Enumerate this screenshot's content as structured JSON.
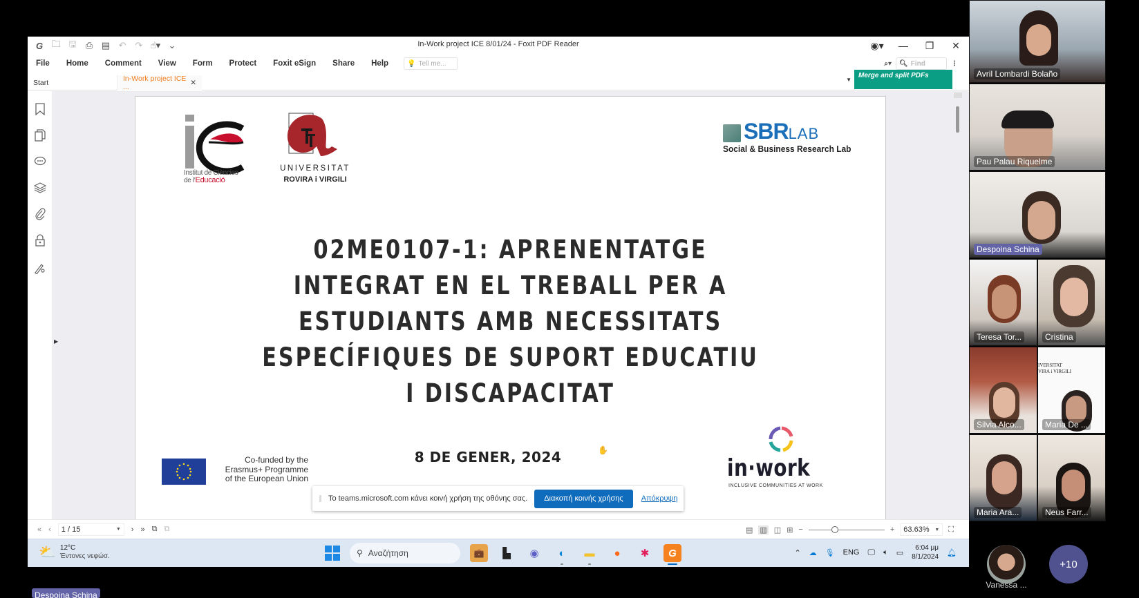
{
  "app": {
    "window_title": "In-Work project ICE 8/01/24 - Foxit PDF Reader",
    "menu": [
      "File",
      "Home",
      "Comment",
      "View",
      "Form",
      "Protect",
      "Foxit eSign",
      "Share",
      "Help"
    ],
    "tell_me_placeholder": "Tell me...",
    "find_placeholder": "Find",
    "tabs": [
      {
        "label": "Start",
        "active": false
      },
      {
        "label": "In-Work project ICE ...",
        "active": true
      }
    ],
    "merge_banner": "Merge and split PDFs",
    "colors": {
      "accent": "#f07c1b",
      "merge_banner": "#0a9f84"
    }
  },
  "slide": {
    "logos": {
      "ice": {
        "line1": "Institut de Ciències",
        "line2_prefix": "de l'",
        "line2_accent": "Educació"
      },
      "urv": {
        "line1": "UNIVERSITAT",
        "line2": "ROVIRA i VIRGILI"
      },
      "sbr": {
        "name_main": "SBR",
        "name_sub": "LAB",
        "tagline": "Social & Business Research Lab"
      },
      "eu": {
        "line1": "Co-funded by the",
        "line2": "Erasmus+ Programme",
        "line3": "of the European Union"
      },
      "inwork": {
        "name": "in·work",
        "tagline": "INCLUSIVE COMMUNITIES AT WORK"
      }
    },
    "title_lines": [
      "02ME0107-1: APRENENTATGE",
      "INTEGRAT EN EL TREBALL PER A",
      "ESTUDIANTS AMB NECESSITATS",
      "ESPECÍFIQUES DE SUPORT EDUCATIU",
      "I DISCAPACITAT"
    ],
    "date": "8 DE GENER, 2024"
  },
  "share_bar": {
    "message": "Το teams.microsoft.com κάνει κοινή χρήση της οθόνης σας.",
    "stop_button": "Διακοπή κοινής χρήσης",
    "hide_link": "Απόκρυψη"
  },
  "statusbar": {
    "page_current": "1 / 15",
    "zoom": "63.63%",
    "zoom_fraction": 0.35
  },
  "taskbar": {
    "weather_temp": "12°C",
    "weather_desc": "Έντονες νεφώσ.",
    "search_placeholder": "Αναζήτηση",
    "language": "ENG",
    "time": "6:04 μμ",
    "date": "8/1/2024"
  },
  "participants": {
    "tiles": [
      {
        "name": "Avril Lombardi Bolaño",
        "speaking": false
      },
      {
        "name": "Pau Palau Riquelme",
        "speaking": false
      },
      {
        "name": "Despoina Schina",
        "speaking": true
      },
      {
        "name": "Teresa Tor...",
        "speaking": false
      },
      {
        "name": "Cristina",
        "speaking": false
      },
      {
        "name": "Silvia Alco...",
        "speaking": false
      },
      {
        "name": "Maria De ...",
        "speaking": false
      },
      {
        "name": "Maria Ara...",
        "speaking": false
      },
      {
        "name": "Neus Farr...",
        "speaking": false
      }
    ],
    "avatar_name": "Vanessa ...",
    "more_count": "+10",
    "presenter": "Despoina Schina"
  }
}
